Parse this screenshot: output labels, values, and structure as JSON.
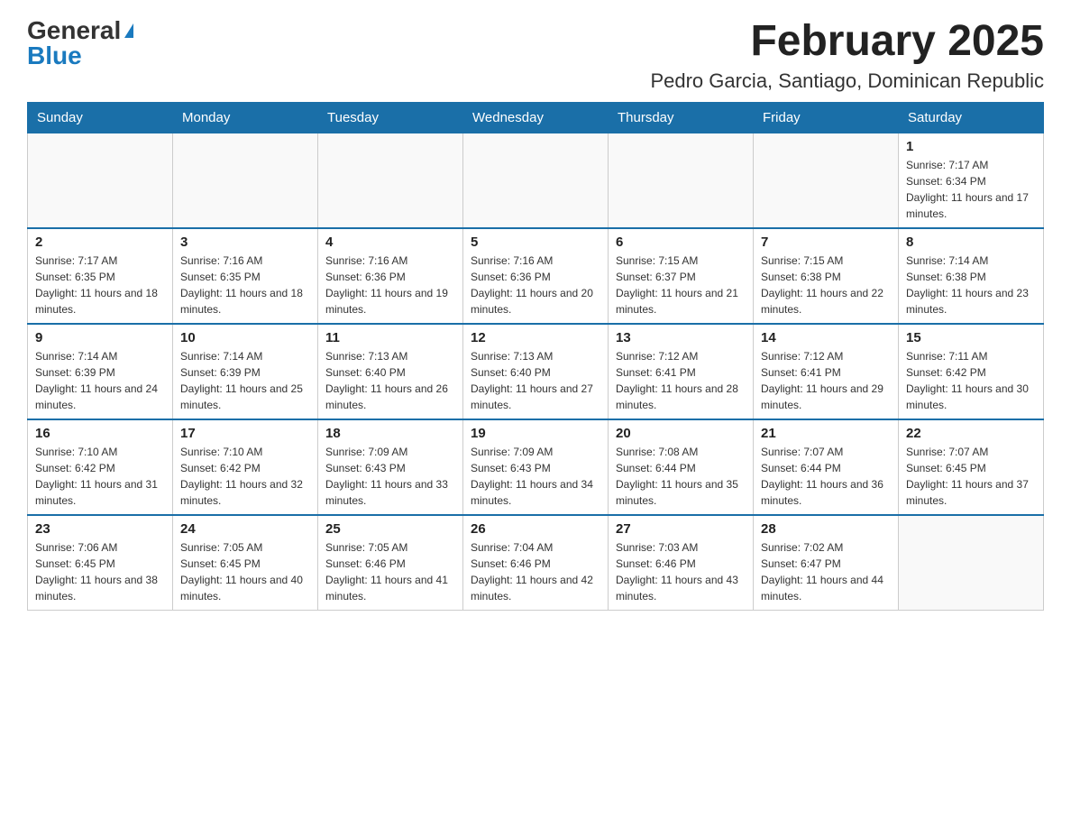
{
  "header": {
    "logo_general": "General",
    "logo_blue": "Blue",
    "month_title": "February 2025",
    "location": "Pedro Garcia, Santiago, Dominican Republic"
  },
  "weekdays": [
    "Sunday",
    "Monday",
    "Tuesday",
    "Wednesday",
    "Thursday",
    "Friday",
    "Saturday"
  ],
  "weeks": [
    [
      {
        "day": "",
        "info": ""
      },
      {
        "day": "",
        "info": ""
      },
      {
        "day": "",
        "info": ""
      },
      {
        "day": "",
        "info": ""
      },
      {
        "day": "",
        "info": ""
      },
      {
        "day": "",
        "info": ""
      },
      {
        "day": "1",
        "info": "Sunrise: 7:17 AM\nSunset: 6:34 PM\nDaylight: 11 hours and 17 minutes."
      }
    ],
    [
      {
        "day": "2",
        "info": "Sunrise: 7:17 AM\nSunset: 6:35 PM\nDaylight: 11 hours and 18 minutes."
      },
      {
        "day": "3",
        "info": "Sunrise: 7:16 AM\nSunset: 6:35 PM\nDaylight: 11 hours and 18 minutes."
      },
      {
        "day": "4",
        "info": "Sunrise: 7:16 AM\nSunset: 6:36 PM\nDaylight: 11 hours and 19 minutes."
      },
      {
        "day": "5",
        "info": "Sunrise: 7:16 AM\nSunset: 6:36 PM\nDaylight: 11 hours and 20 minutes."
      },
      {
        "day": "6",
        "info": "Sunrise: 7:15 AM\nSunset: 6:37 PM\nDaylight: 11 hours and 21 minutes."
      },
      {
        "day": "7",
        "info": "Sunrise: 7:15 AM\nSunset: 6:38 PM\nDaylight: 11 hours and 22 minutes."
      },
      {
        "day": "8",
        "info": "Sunrise: 7:14 AM\nSunset: 6:38 PM\nDaylight: 11 hours and 23 minutes."
      }
    ],
    [
      {
        "day": "9",
        "info": "Sunrise: 7:14 AM\nSunset: 6:39 PM\nDaylight: 11 hours and 24 minutes."
      },
      {
        "day": "10",
        "info": "Sunrise: 7:14 AM\nSunset: 6:39 PM\nDaylight: 11 hours and 25 minutes."
      },
      {
        "day": "11",
        "info": "Sunrise: 7:13 AM\nSunset: 6:40 PM\nDaylight: 11 hours and 26 minutes."
      },
      {
        "day": "12",
        "info": "Sunrise: 7:13 AM\nSunset: 6:40 PM\nDaylight: 11 hours and 27 minutes."
      },
      {
        "day": "13",
        "info": "Sunrise: 7:12 AM\nSunset: 6:41 PM\nDaylight: 11 hours and 28 minutes."
      },
      {
        "day": "14",
        "info": "Sunrise: 7:12 AM\nSunset: 6:41 PM\nDaylight: 11 hours and 29 minutes."
      },
      {
        "day": "15",
        "info": "Sunrise: 7:11 AM\nSunset: 6:42 PM\nDaylight: 11 hours and 30 minutes."
      }
    ],
    [
      {
        "day": "16",
        "info": "Sunrise: 7:10 AM\nSunset: 6:42 PM\nDaylight: 11 hours and 31 minutes."
      },
      {
        "day": "17",
        "info": "Sunrise: 7:10 AM\nSunset: 6:42 PM\nDaylight: 11 hours and 32 minutes."
      },
      {
        "day": "18",
        "info": "Sunrise: 7:09 AM\nSunset: 6:43 PM\nDaylight: 11 hours and 33 minutes."
      },
      {
        "day": "19",
        "info": "Sunrise: 7:09 AM\nSunset: 6:43 PM\nDaylight: 11 hours and 34 minutes."
      },
      {
        "day": "20",
        "info": "Sunrise: 7:08 AM\nSunset: 6:44 PM\nDaylight: 11 hours and 35 minutes."
      },
      {
        "day": "21",
        "info": "Sunrise: 7:07 AM\nSunset: 6:44 PM\nDaylight: 11 hours and 36 minutes."
      },
      {
        "day": "22",
        "info": "Sunrise: 7:07 AM\nSunset: 6:45 PM\nDaylight: 11 hours and 37 minutes."
      }
    ],
    [
      {
        "day": "23",
        "info": "Sunrise: 7:06 AM\nSunset: 6:45 PM\nDaylight: 11 hours and 38 minutes."
      },
      {
        "day": "24",
        "info": "Sunrise: 7:05 AM\nSunset: 6:45 PM\nDaylight: 11 hours and 40 minutes."
      },
      {
        "day": "25",
        "info": "Sunrise: 7:05 AM\nSunset: 6:46 PM\nDaylight: 11 hours and 41 minutes."
      },
      {
        "day": "26",
        "info": "Sunrise: 7:04 AM\nSunset: 6:46 PM\nDaylight: 11 hours and 42 minutes."
      },
      {
        "day": "27",
        "info": "Sunrise: 7:03 AM\nSunset: 6:46 PM\nDaylight: 11 hours and 43 minutes."
      },
      {
        "day": "28",
        "info": "Sunrise: 7:02 AM\nSunset: 6:47 PM\nDaylight: 11 hours and 44 minutes."
      },
      {
        "day": "",
        "info": ""
      }
    ]
  ]
}
